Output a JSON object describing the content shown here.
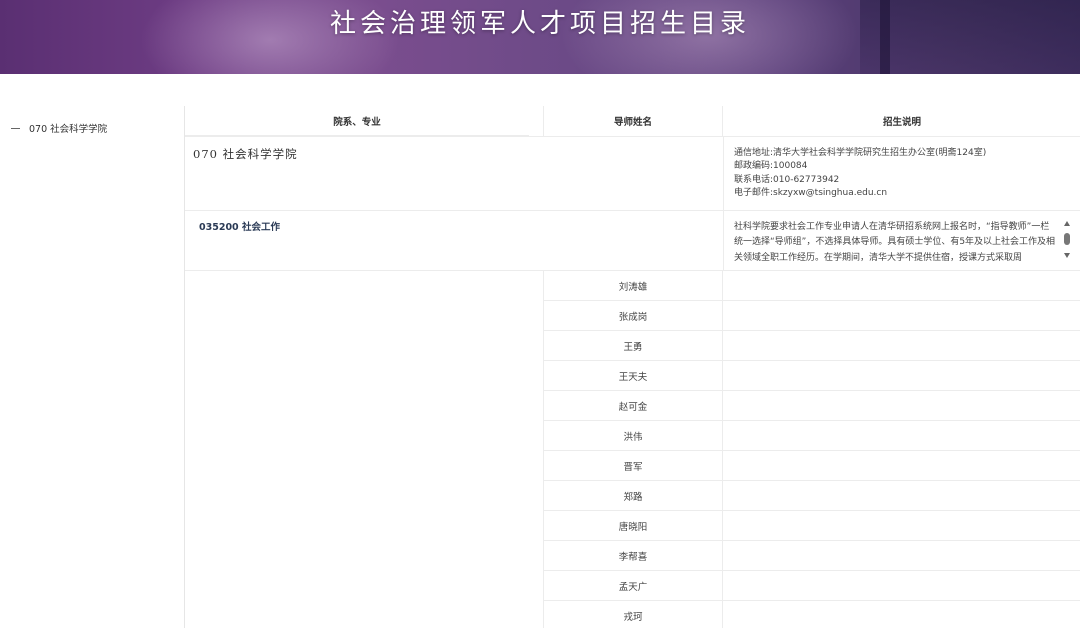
{
  "banner": {
    "title": "社会治理领军人才项目招生目录"
  },
  "sidebar": {
    "items": [
      {
        "label": "070 社会科学学院"
      }
    ]
  },
  "table": {
    "headers": {
      "department": "院系、专业",
      "tutor": "导师姓名",
      "notes": "招生说明"
    },
    "school": {
      "name": "070  社会科学学院",
      "info": [
        "通信地址:清华大学社会科学学院研究生招生办公室(明斋124室)",
        "邮政编码:100084",
        "联系电话:010-62773942",
        "电子邮件:skzyxw@tsinghua.edu.cn"
      ]
    },
    "major": {
      "code": "035200  社会工作",
      "note": "社科学院要求社会工作专业申请人在清华研招系统网上报名时，“指导教师”一栏统一选择“导师组”，不选择具体导师。具有硕士学位、有5年及以上社会工作及相关领域全职工作经历。在学期间，清华大学不提供住宿，授课方式采取周"
    },
    "tutors": [
      "刘涛雄",
      "张成岗",
      "王勇",
      "王天夫",
      "赵可金",
      "洪伟",
      "晋军",
      "郑路",
      "唐晓阳",
      "李帮喜",
      "孟天广",
      "戎珂"
    ]
  }
}
